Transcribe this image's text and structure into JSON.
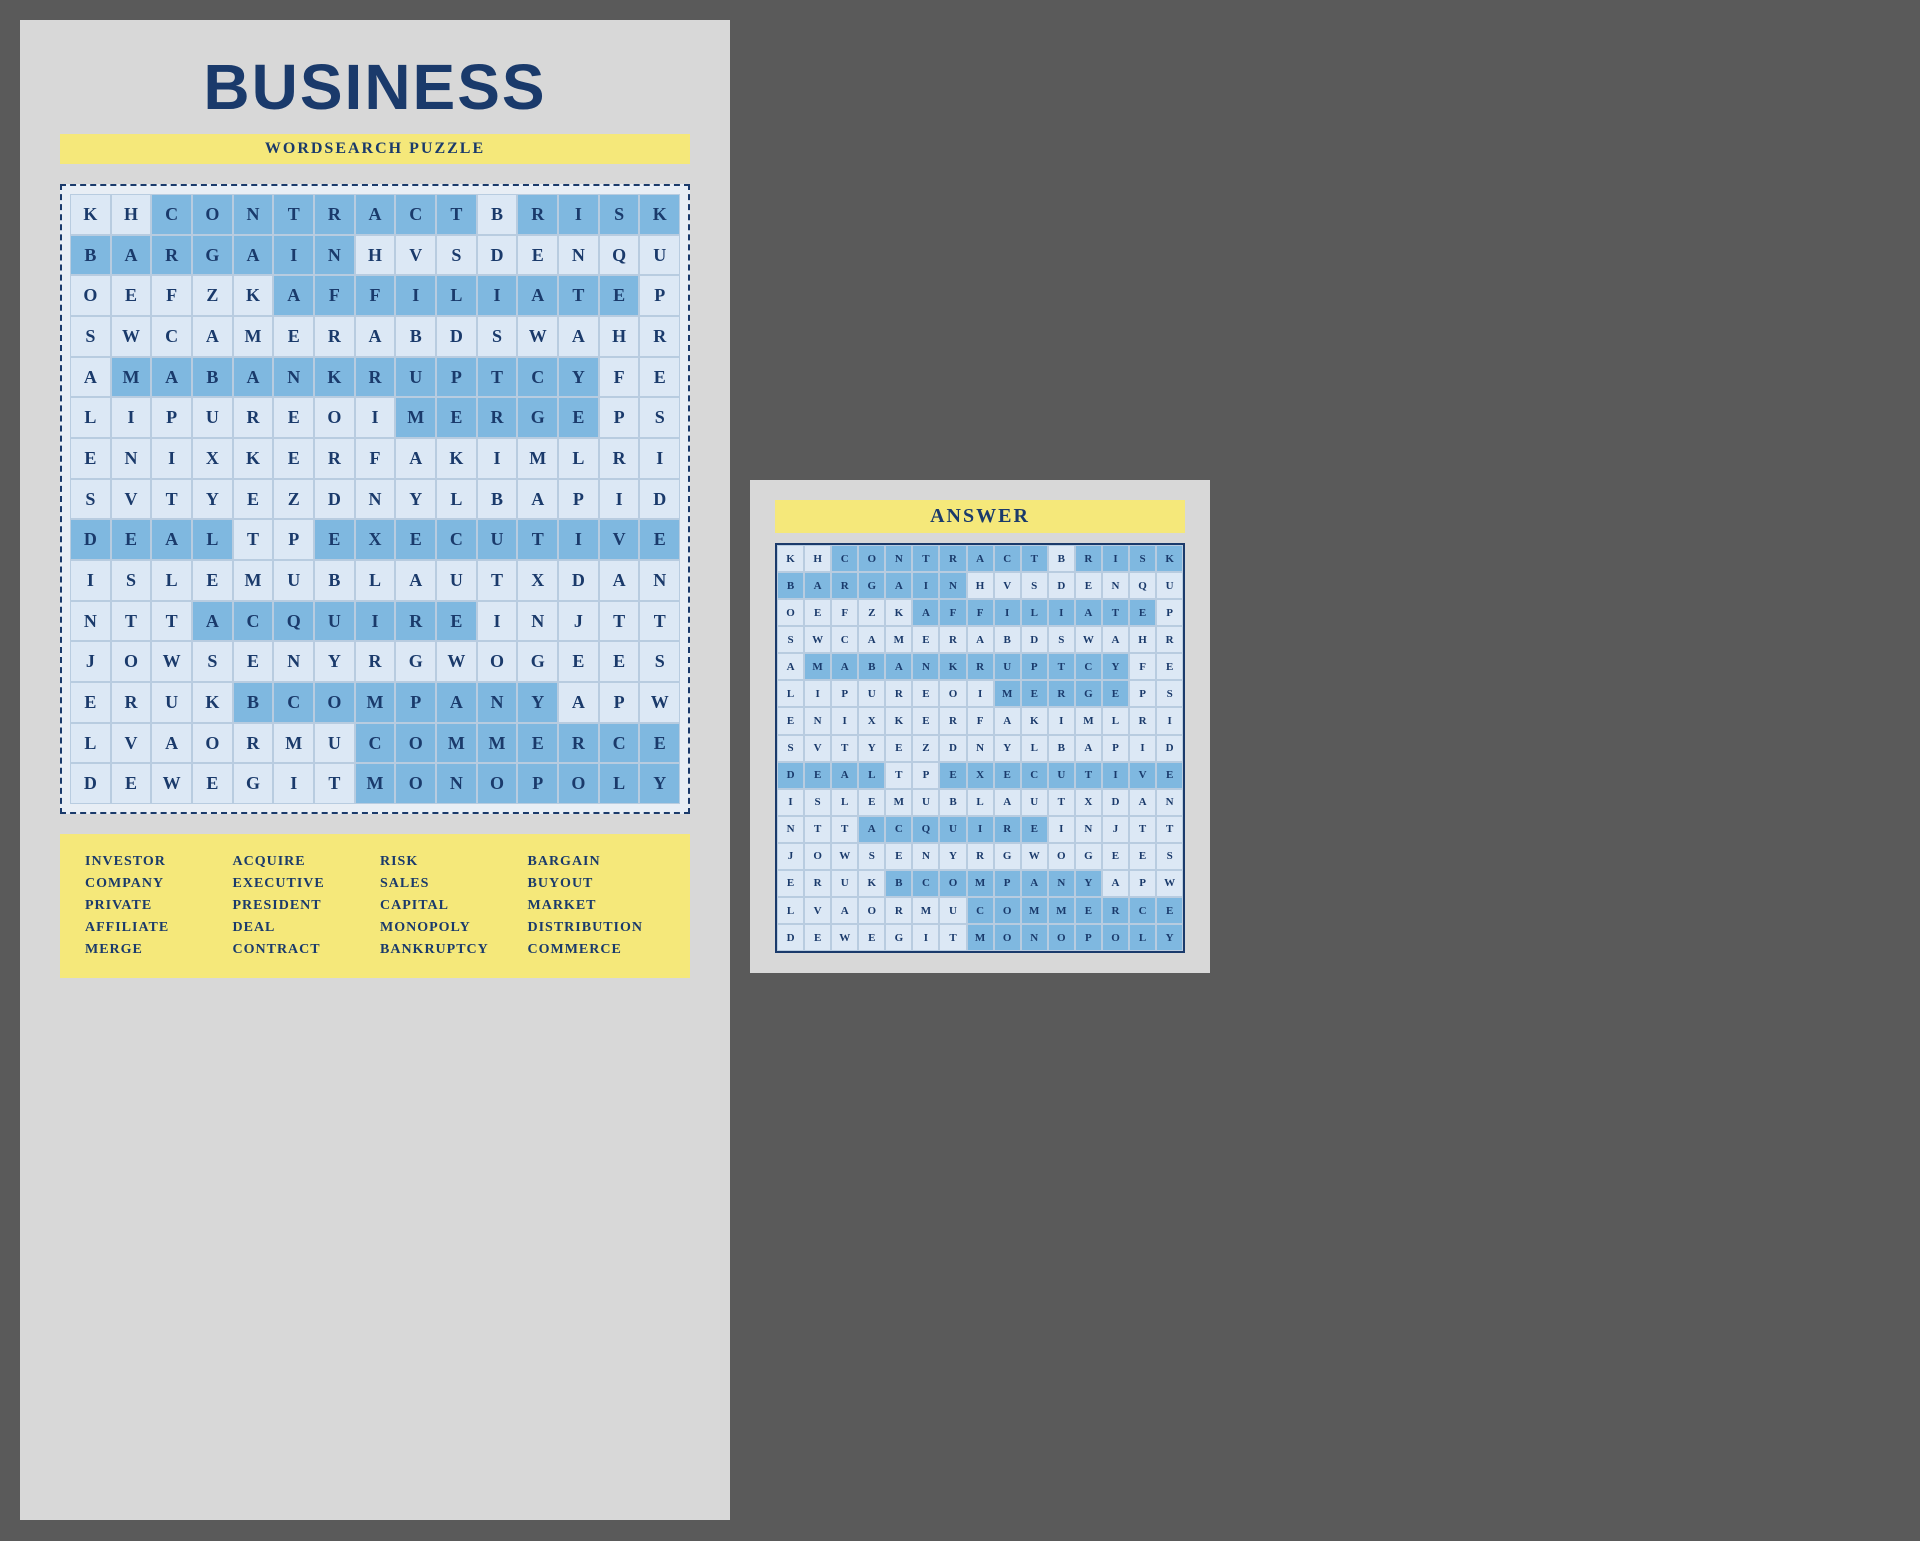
{
  "mainCard": {
    "title": "BUSINESS",
    "subtitle": "WORDSEARCH PUZZLE",
    "answerLabel": "ANSWER"
  },
  "wordList": [
    "INVESTOR",
    "ACQUIRE",
    "RISK",
    "BARGAIN",
    "COMPANY",
    "EXECUTIVE",
    "SALES",
    "BUYOUT",
    "PRIVATE",
    "PRESIDENT",
    "CAPITAL",
    "MARKET",
    "AFFILIATE",
    "DEAL",
    "MONOPOLY",
    "DISTRIBUTION",
    "MERGE",
    "CONTRACT",
    "BANKRUPTCY",
    "COMMERCE"
  ],
  "grid": [
    [
      "K",
      "H",
      "C",
      "O",
      "N",
      "T",
      "R",
      "A",
      "C",
      "T",
      "B",
      "R",
      "I",
      "S",
      "K"
    ],
    [
      "B",
      "A",
      "R",
      "G",
      "A",
      "I",
      "N",
      "H",
      "V",
      "S",
      "D",
      "E",
      "N",
      "Q",
      "U"
    ],
    [
      "O",
      "E",
      "F",
      "Z",
      "K",
      "A",
      "F",
      "F",
      "I",
      "L",
      "I",
      "A",
      "T",
      "E",
      "P"
    ],
    [
      "S",
      "W",
      "C",
      "A",
      "M",
      "E",
      "R",
      "A",
      "B",
      "D",
      "S",
      "W",
      "A",
      "H",
      "R"
    ],
    [
      "A",
      "M",
      "A",
      "B",
      "A",
      "N",
      "K",
      "R",
      "U",
      "P",
      "T",
      "C",
      "Y",
      "F",
      "E"
    ],
    [
      "L",
      "I",
      "P",
      "U",
      "R",
      "E",
      "O",
      "I",
      "M",
      "E",
      "R",
      "G",
      "E",
      "P",
      "S"
    ],
    [
      "E",
      "N",
      "I",
      "X",
      "K",
      "E",
      "R",
      "F",
      "A",
      "K",
      "I",
      "M",
      "L",
      "R",
      "I"
    ],
    [
      "S",
      "V",
      "T",
      "Y",
      "E",
      "Z",
      "D",
      "N",
      "Y",
      "L",
      "B",
      "A",
      "P",
      "I",
      "D"
    ],
    [
      "D",
      "E",
      "A",
      "L",
      "T",
      "P",
      "E",
      "X",
      "E",
      "C",
      "U",
      "T",
      "I",
      "V",
      "E"
    ],
    [
      "I",
      "S",
      "L",
      "E",
      "M",
      "U",
      "B",
      "L",
      "A",
      "U",
      "T",
      "X",
      "D",
      "A",
      "N"
    ],
    [
      "N",
      "T",
      "T",
      "A",
      "C",
      "Q",
      "U",
      "I",
      "R",
      "E",
      "I",
      "N",
      "J",
      "T",
      "T"
    ],
    [
      "J",
      "O",
      "W",
      "S",
      "E",
      "N",
      "Y",
      "R",
      "G",
      "W",
      "O",
      "G",
      "E",
      "E",
      "S"
    ],
    [
      "E",
      "R",
      "U",
      "K",
      "B",
      "C",
      "O",
      "M",
      "P",
      "A",
      "N",
      "Y",
      "A",
      "P",
      "W"
    ],
    [
      "L",
      "V",
      "A",
      "O",
      "R",
      "M",
      "U",
      "C",
      "O",
      "M",
      "M",
      "E",
      "R",
      "C",
      "E"
    ],
    [
      "D",
      "E",
      "W",
      "E",
      "G",
      "I",
      "T",
      "M",
      "O",
      "N",
      "O",
      "P",
      "O",
      "L",
      "Y"
    ]
  ],
  "highlighted": {
    "CONTRACT": [
      [
        0,
        2
      ],
      [
        0,
        3
      ],
      [
        0,
        4
      ],
      [
        0,
        5
      ],
      [
        0,
        6
      ],
      [
        0,
        7
      ],
      [
        0,
        8
      ],
      [
        0,
        9
      ]
    ],
    "RISK": [
      [
        0,
        11
      ],
      [
        0,
        12
      ],
      [
        0,
        13
      ],
      [
        0,
        14
      ]
    ],
    "BARGAIN": [
      [
        1,
        0
      ],
      [
        1,
        1
      ],
      [
        1,
        2
      ],
      [
        1,
        3
      ],
      [
        1,
        4
      ],
      [
        1,
        5
      ],
      [
        1,
        6
      ]
    ],
    "AFFILIATE": [
      [
        2,
        5
      ],
      [
        2,
        6
      ],
      [
        2,
        7
      ],
      [
        2,
        8
      ],
      [
        2,
        9
      ],
      [
        2,
        10
      ],
      [
        2,
        11
      ],
      [
        2,
        12
      ],
      [
        2,
        13
      ]
    ],
    "BANKRUPT": [
      [
        4,
        1
      ],
      [
        4,
        2
      ],
      [
        4,
        3
      ],
      [
        4,
        4
      ],
      [
        4,
        5
      ],
      [
        4,
        6
      ],
      [
        4,
        7
      ],
      [
        4,
        8
      ],
      [
        4,
        9
      ],
      [
        4,
        10
      ]
    ],
    "MERGE": [
      [
        5,
        8
      ],
      [
        5,
        9
      ],
      [
        5,
        10
      ],
      [
        5,
        11
      ],
      [
        5,
        12
      ]
    ],
    "DEAL": [
      [
        8,
        0
      ],
      [
        8,
        1
      ],
      [
        8,
        2
      ],
      [
        8,
        3
      ]
    ],
    "EXECUTIVE": [
      [
        8,
        6
      ],
      [
        8,
        7
      ],
      [
        8,
        8
      ],
      [
        8,
        9
      ],
      [
        8,
        10
      ],
      [
        8,
        11
      ],
      [
        8,
        12
      ],
      [
        8,
        13
      ],
      [
        8,
        14
      ]
    ],
    "ACQUIRE": [
      [
        10,
        3
      ],
      [
        10,
        4
      ],
      [
        10,
        5
      ],
      [
        10,
        6
      ],
      [
        10,
        7
      ],
      [
        10,
        8
      ],
      [
        10,
        9
      ]
    ],
    "COMPANY": [
      [
        12,
        4
      ],
      [
        12,
        5
      ],
      [
        12,
        6
      ],
      [
        12,
        7
      ],
      [
        12,
        8
      ],
      [
        12,
        9
      ],
      [
        12,
        10
      ],
      [
        12,
        11
      ]
    ],
    "COMMERCE": [
      [
        13,
        7
      ],
      [
        13,
        8
      ],
      [
        13,
        9
      ],
      [
        13,
        10
      ],
      [
        13,
        11
      ],
      [
        13,
        12
      ],
      [
        13,
        13
      ],
      [
        13,
        14
      ]
    ],
    "MONOPOLY": [
      [
        14,
        7
      ],
      [
        14,
        8
      ],
      [
        14,
        9
      ],
      [
        14,
        10
      ],
      [
        14,
        11
      ],
      [
        14,
        12
      ],
      [
        14,
        13
      ],
      [
        14,
        14
      ]
    ],
    "CAPITAL": [
      [
        5,
        8
      ]
    ],
    "SALES": [
      [
        6,
        0
      ]
    ],
    "INVESTOR": [
      [
        2,
        0
      ]
    ],
    "PRIVATE": [
      [
        3,
        0
      ]
    ],
    "BUYOUT": [
      [
        1,
        13
      ]
    ],
    "MARKET": [
      [
        11,
        3
      ]
    ],
    "DISTRIBUTION": [
      [
        9,
        14
      ]
    ],
    "PRESIDENT": [
      [
        3,
        12
      ]
    ],
    "BANKRUPTCY": [
      [
        4,
        1
      ],
      [
        4,
        2
      ],
      [
        4,
        3
      ],
      [
        4,
        4
      ],
      [
        4,
        5
      ],
      [
        4,
        6
      ],
      [
        4,
        7
      ],
      [
        4,
        8
      ],
      [
        4,
        9
      ],
      [
        4,
        10
      ],
      [
        4,
        11
      ],
      [
        4,
        12
      ]
    ]
  },
  "highlightedCells": {
    "0": {
      "2": true,
      "3": true,
      "4": true,
      "5": true,
      "6": true,
      "7": true,
      "8": true,
      "9": true,
      "11": true,
      "12": true,
      "13": true,
      "14": true
    },
    "1": {
      "0": true,
      "1": true,
      "2": true,
      "3": true,
      "4": true,
      "5": true,
      "6": true
    },
    "2": {
      "5": true,
      "6": true,
      "7": true,
      "8": true,
      "9": true,
      "10": true,
      "11": true,
      "12": true,
      "13": true
    },
    "4": {
      "1": true,
      "2": true,
      "3": true,
      "4": true,
      "5": true,
      "6": true,
      "7": true,
      "8": true,
      "9": true,
      "10": true,
      "11": true,
      "12": true
    },
    "5": {
      "8": true,
      "9": true,
      "10": true,
      "11": true,
      "12": true
    },
    "8": {
      "0": true,
      "1": true,
      "2": true,
      "3": true,
      "6": true,
      "7": true,
      "8": true,
      "9": true,
      "10": true,
      "11": true,
      "12": true,
      "13": true,
      "14": true
    },
    "10": {
      "3": true,
      "4": true,
      "5": true,
      "6": true,
      "7": true,
      "8": true,
      "9": true
    },
    "12": {
      "4": true,
      "5": true,
      "6": true,
      "7": true,
      "8": true,
      "9": true,
      "10": true,
      "11": true
    },
    "13": {
      "7": true,
      "8": true,
      "9": true,
      "10": true,
      "11": true,
      "12": true,
      "13": true,
      "14": true
    },
    "14": {
      "7": true,
      "8": true,
      "9": true,
      "10": true,
      "11": true,
      "12": true,
      "13": true,
      "14": true
    }
  }
}
